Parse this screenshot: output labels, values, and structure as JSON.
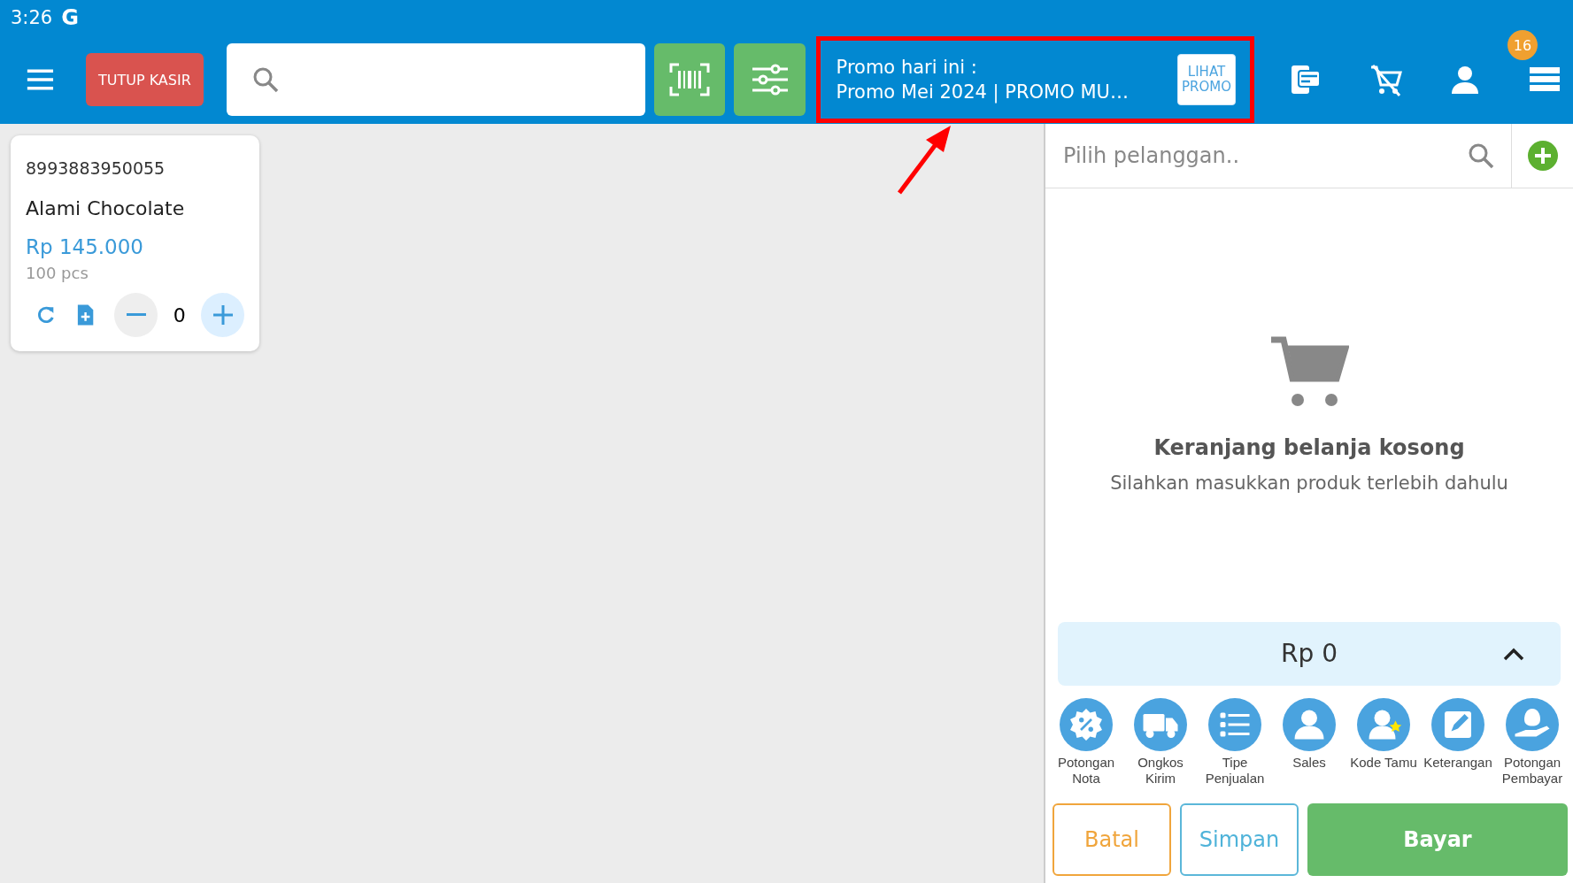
{
  "status_bar": {
    "time": "3:26",
    "app_letter": "G"
  },
  "toolbar": {
    "close_register_button": "TUTUP KASIR",
    "promo": {
      "heading": "Promo hari ini :",
      "text": "Promo Mei 2024 | PROMO MU…",
      "button": "LIHAT PROMO"
    },
    "badge": "16"
  },
  "products": [
    {
      "barcode": "8993883950055",
      "name": "Alami Chocolate",
      "price": "Rp 145.000",
      "stock": "100 pcs",
      "quantity": "0"
    }
  ],
  "customer": {
    "placeholder": "Pilih pelanggan.."
  },
  "cart": {
    "empty_title": "Keranjang belanja kosong",
    "empty_subtitle": "Silahkan masukkan produk terlebih dahulu",
    "total": "Rp 0"
  },
  "actions": [
    {
      "kind": "discount",
      "label": "Potongan Nota"
    },
    {
      "kind": "shipping",
      "label": "Ongkos Kirim"
    },
    {
      "kind": "list",
      "label": "Tipe Penjualan"
    },
    {
      "kind": "person",
      "label": "Sales"
    },
    {
      "kind": "guest",
      "label": "Kode Tamu"
    },
    {
      "kind": "note",
      "label": "Keterangan"
    },
    {
      "kind": "money",
      "label": "Potongan Pembayar"
    }
  ],
  "buttons": [
    {
      "kind": "cancel",
      "label": "Batal"
    },
    {
      "kind": "save",
      "label": "Simpan"
    },
    {
      "kind": "pay",
      "label": "Bayar"
    }
  ]
}
